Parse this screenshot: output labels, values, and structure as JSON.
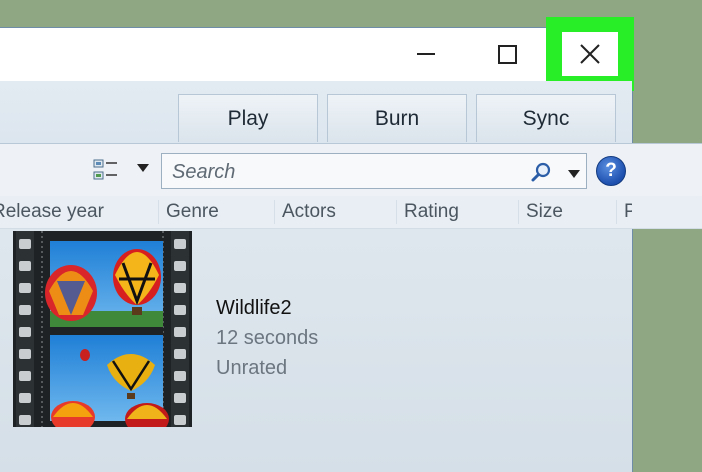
{
  "window": {
    "controls": {
      "minimize": "minimize",
      "maximize": "maximize",
      "close": "close"
    }
  },
  "toolbar": {
    "tabs": [
      {
        "label": "Play"
      },
      {
        "label": "Burn"
      },
      {
        "label": "Sync"
      }
    ]
  },
  "search": {
    "placeholder": "Search",
    "help_glyph": "?"
  },
  "columns": [
    "Release year",
    "Genre",
    "Actors",
    "Rating",
    "Size",
    "P"
  ],
  "media_item": {
    "title": "Wildlife2",
    "duration": "12 seconds",
    "rating": "Unrated",
    "thumbnail_icon": "film-strip-hot-air-balloons"
  },
  "colors": {
    "highlight": "#27ee27",
    "background": "#8fa783",
    "help_blue": "#1d4fae"
  }
}
